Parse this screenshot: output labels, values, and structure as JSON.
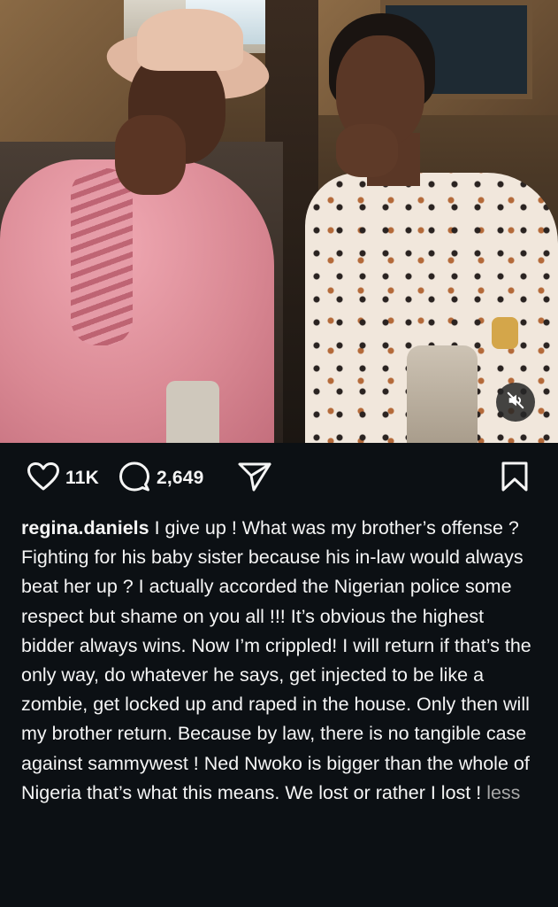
{
  "post": {
    "likes": "11K",
    "comments": "2,649"
  },
  "caption": {
    "username": "regina.daniels",
    "text": " I give up ! What was my brother’s offense ? Fighting for his baby sister because his in-law would always beat her up ? I actually accorded the Nigerian police some respect but shame on you all !!! It’s obvious the highest bidder always wins. Now I’m crippled! I will return if that’s the only way, do whatever he says, get injected to be like a zombie, get locked up and raped in the house. Only then will my brother return. Because by law, there is no tangible case against sammywest ! Ned Nwoko is bigger than the whole of Nigeria that’s what this means. We lost or rather I lost ! ",
    "more_label": "less"
  },
  "icons": {
    "like": "heart-outline-icon",
    "comment": "comment-bubble-icon",
    "share": "paper-plane-icon",
    "save": "bookmark-icon",
    "mute": "speaker-muted-icon"
  },
  "colors": {
    "background": "#0c1014",
    "text": "#f5f5f5",
    "muted_text": "#a8a8a8"
  }
}
